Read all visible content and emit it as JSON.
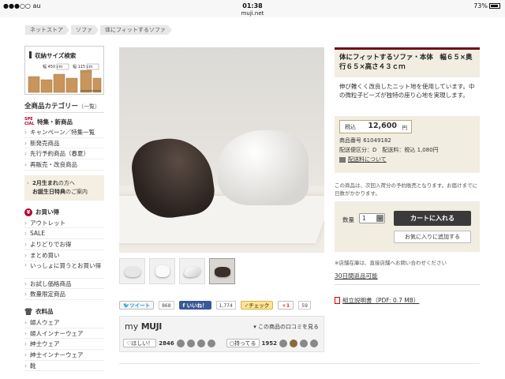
{
  "status": {
    "carrier": "●●●○○ au",
    "time": "01:38",
    "url": "muji.net",
    "battery": "73%"
  },
  "breadcrumbs": [
    "ネットストア",
    "ソファ",
    "体にフィットするソファ"
  ],
  "sidebar": {
    "banner_title": "収納サイズ検索",
    "banner_labels": [
      "幅 450 cm",
      "幅 115 cm"
    ],
    "category_title": "全商品カテゴリー",
    "category_sub": "（一覧）",
    "special": {
      "badge": "SPE CIAL",
      "heading": "特集・新商品",
      "items": [
        "キャンペーン／特集一覧",
        "新発売商品",
        "先行予約商品（春夏）",
        "再販売・改良商品"
      ]
    },
    "birthday": {
      "line1_a": "2月生まれ",
      "line1_b": "の方へ",
      "line2_a": "お誕生日特典",
      "line2_b": "のご案内"
    },
    "deals": {
      "heading": "お買い得",
      "items": [
        "アウトレット",
        "SALE",
        "よりどりでお得",
        "まとめ買い",
        "いっしょに買うとお買い得",
        "お試し価格商品",
        "数量限定商品"
      ]
    },
    "clothing": {
      "heading": "衣料品",
      "items": [
        "婦人ウェア",
        "婦人インナーウェア",
        "紳士ウェア",
        "紳士インナーウェア",
        "靴"
      ]
    }
  },
  "social": {
    "tweet": "ツイート",
    "tweet_count": "868",
    "like": "いいね！",
    "like_count": "1,774",
    "check": "チェック",
    "gplus": "+1",
    "gplus_count": "59"
  },
  "mymuji": {
    "logo_my": "my",
    "logo_muji": "MUJI",
    "link": "この商品の口コミを見る",
    "want_label": "ほしい！",
    "want_count": "2846",
    "have_label": "持ってる",
    "have_count": "1952"
  },
  "product": {
    "title": "体にフィットするソファ・本体　幅６５×奥行６５×高さ４３ｃｍ",
    "description": "伸び難くく改良したニット地を使用しています。中の微粒子ビーズが独特の座り心地を実現します。",
    "price_label": "税込",
    "price": "12,600",
    "price_unit": "円",
    "product_no": "商品番号 61049182",
    "shipping": "配送便区分：D　配送料：税込 1,080円",
    "shipping_link": "配送料について",
    "note": "この商品は、次回入荷分の予約販売となります。お届けまでに日数がかかります。",
    "qty_label": "数量",
    "qty_value": "1",
    "cart_button": "カートに入れる",
    "fav_button": "お気に入りに追加する",
    "store_note": "※店舗在庫は、直接店舗へお問い合わせください",
    "return_link": "30日間返品可能",
    "manual_link": "組立説明書（PDF: 0.7 MB）"
  }
}
